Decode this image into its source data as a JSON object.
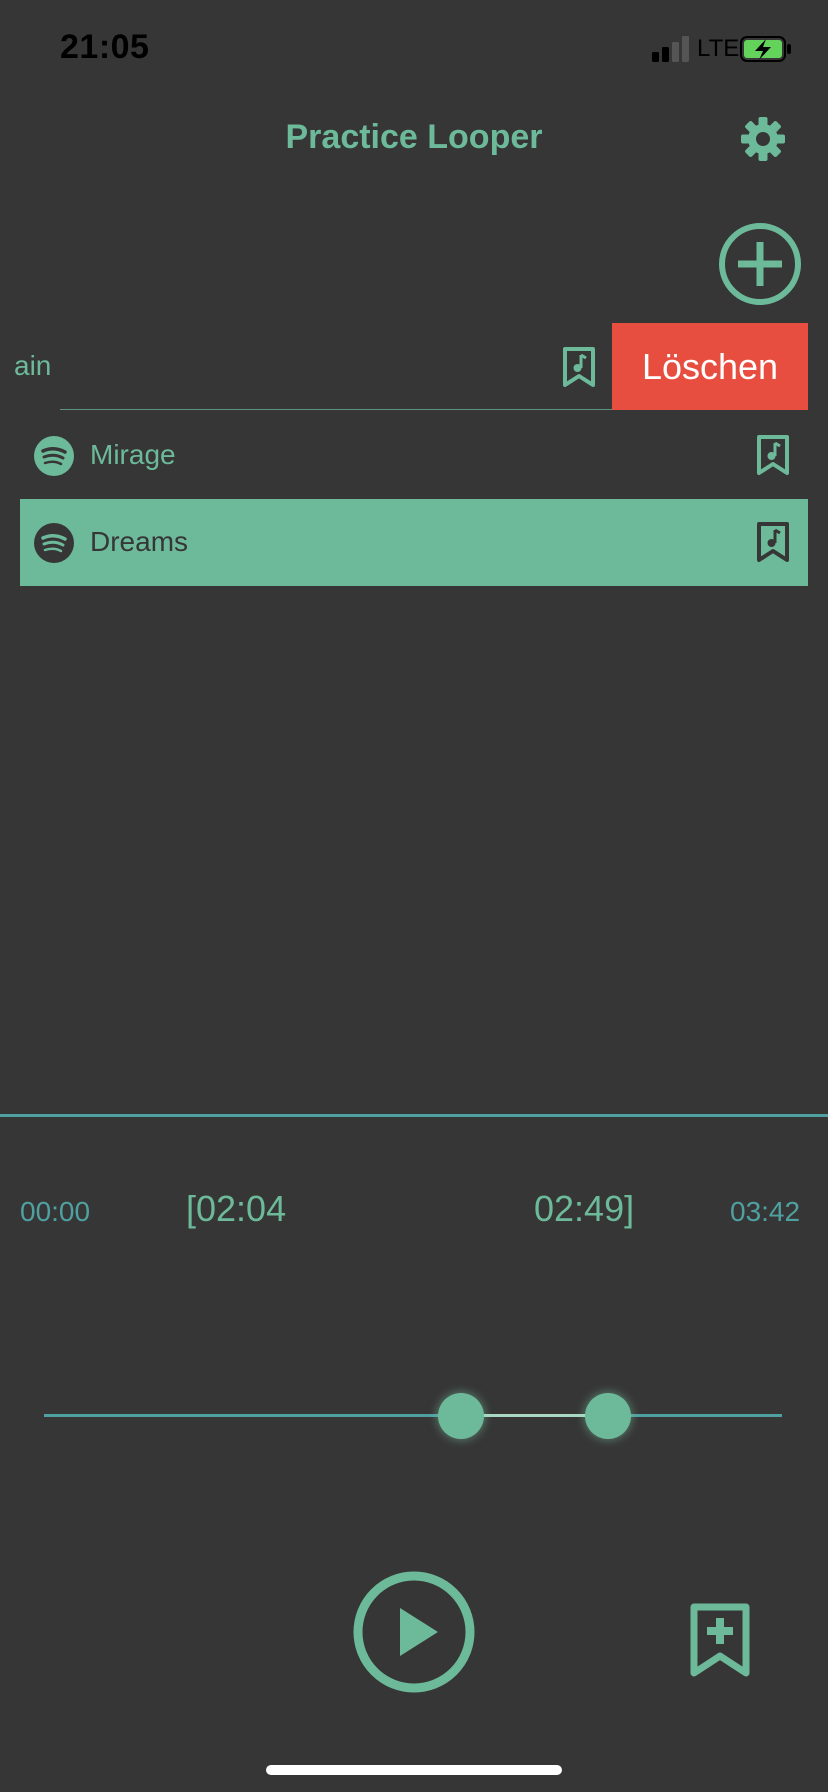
{
  "status_bar": {
    "time": "21:05",
    "network": "LTE"
  },
  "header": {
    "title": "Practice Looper"
  },
  "list": {
    "swiped_row": {
      "label": "ain",
      "delete_label": "Löschen"
    },
    "items": [
      {
        "label": "Mirage",
        "selected": false
      },
      {
        "label": "Dreams",
        "selected": true
      }
    ]
  },
  "player": {
    "time_start": "00:00",
    "loop_start": "[02:04",
    "loop_end": "02:49]",
    "time_end": "03:42"
  },
  "colors": {
    "accent": "#6dba9b",
    "background": "#363636",
    "delete": "#e84e3f",
    "track": "#4fa0a0"
  }
}
